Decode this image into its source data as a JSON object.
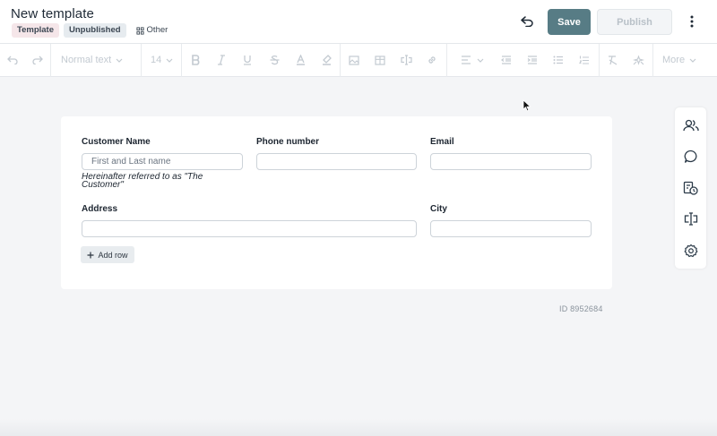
{
  "header": {
    "title": "New template",
    "badges": {
      "template": "Template",
      "unpublished": "Unpublished",
      "other": "Other"
    },
    "save_label": "Save",
    "publish_label": "Publish"
  },
  "toolbar": {
    "text_style": "Normal text",
    "font_size": "14",
    "more_label": "More"
  },
  "form": {
    "customer_name": {
      "label": "Customer Name",
      "placeholder": "First and Last name",
      "hint": "Hereinafter referred to as \"The Customer\""
    },
    "phone": {
      "label": "Phone number",
      "placeholder": ""
    },
    "email": {
      "label": "Email",
      "placeholder": ""
    },
    "address": {
      "label": "Address",
      "placeholder": ""
    },
    "city": {
      "label": "City",
      "placeholder": ""
    },
    "add_row_label": "Add row"
  },
  "doc_id": "ID 8952684",
  "colors": {
    "accent": "#577c85",
    "page_bg": "#f4f5f7",
    "badge_template_bg": "#f5e6e9",
    "badge_unpublished_bg": "#e6ebef"
  },
  "icons": {
    "header": [
      "undo-icon",
      "kebab-menu-icon",
      "template-other-icon"
    ],
    "toolbar": [
      "undo-icon",
      "redo-icon",
      "bold-icon",
      "italic-icon",
      "underline-icon",
      "strikethrough-icon",
      "text-color-icon",
      "highlight-icon",
      "image-icon",
      "table-icon",
      "field-icon",
      "link-icon",
      "align-icon",
      "outdent-icon",
      "indent-icon",
      "bullet-list-icon",
      "numbered-list-icon",
      "clear-format-icon",
      "ai-icon"
    ],
    "rail": [
      "users-icon",
      "comment-icon",
      "history-icon",
      "fields-icon",
      "settings-icon"
    ]
  }
}
